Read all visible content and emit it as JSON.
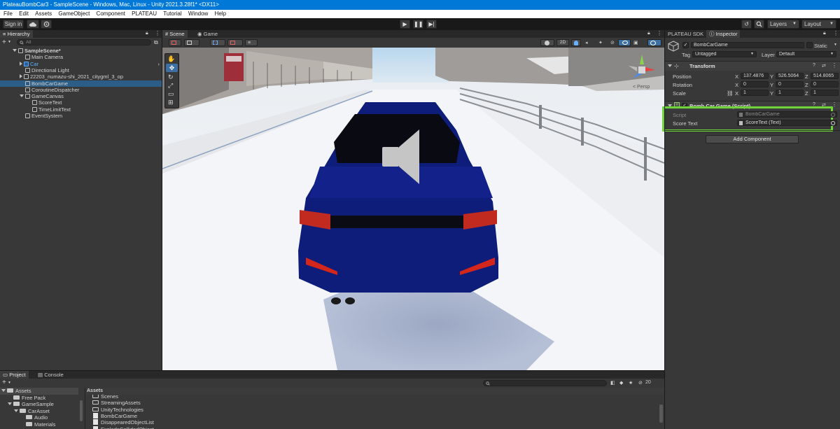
{
  "window": {
    "title": "PlateauBombCar3 - SampleScene - Windows, Mac, Linux - Unity 2021.3.28f1* <DX11>"
  },
  "menu": [
    "File",
    "Edit",
    "Assets",
    "GameObject",
    "Component",
    "PLATEAU",
    "Tutorial",
    "Window",
    "Help"
  ],
  "toolbar": {
    "sign_in": "Sign in",
    "layers": "Layers",
    "layout": "Layout"
  },
  "hierarchy": {
    "tab": "Hierarchy",
    "search_placeholder": "All",
    "items": [
      {
        "label": "SampleScene*",
        "depth": 0,
        "expanded": true,
        "icon": "unity-scene-icon"
      },
      {
        "label": "Main Camera",
        "depth": 1,
        "icon": "gameobject-icon"
      },
      {
        "label": "Car",
        "depth": 1,
        "collapsed": true,
        "icon": "prefab-icon",
        "accent": true
      },
      {
        "label": "Directional Light",
        "depth": 1,
        "icon": "gameobject-icon"
      },
      {
        "label": "22203_numazu-shi_2021_citygml_3_op",
        "depth": 1,
        "collapsed": true,
        "icon": "gameobject-icon"
      },
      {
        "label": "BombCarGame",
        "depth": 1,
        "icon": "gameobject-icon",
        "selected": true
      },
      {
        "label": "CoroutineDispatcher",
        "depth": 1,
        "icon": "gameobject-icon"
      },
      {
        "label": "GameCanvas",
        "depth": 1,
        "expanded": true,
        "icon": "gameobject-icon"
      },
      {
        "label": "ScoreText",
        "depth": 2,
        "icon": "gameobject-icon"
      },
      {
        "label": "TimeLimitText",
        "depth": 2,
        "icon": "gameobject-icon"
      },
      {
        "label": "EventSystem",
        "depth": 1,
        "icon": "gameobject-icon"
      }
    ]
  },
  "scene": {
    "tabs": [
      "Scene",
      "Game"
    ],
    "scale_2d": "2D",
    "gizmo_label": "< Persp"
  },
  "inspector": {
    "tabs": [
      "PLATEAU SDK",
      "Inspector"
    ],
    "object_name": "BombCarGame",
    "static_label": "Static",
    "tag_label": "Tag",
    "tag_value": "Untagged",
    "layer_label": "Layer",
    "layer_value": "Default",
    "transform": {
      "title": "Transform",
      "rows": [
        {
          "label": "Position",
          "x": "137.4876",
          "y": "526.5064",
          "z": "514.8065"
        },
        {
          "label": "Rotation",
          "x": "0",
          "y": "0",
          "z": "0"
        },
        {
          "label": "Scale",
          "x": "1",
          "y": "1",
          "z": "1"
        }
      ]
    },
    "script_component": {
      "title": "Bomb Car Game (Script)",
      "script_label": "Script",
      "script_value": "BombCarGame",
      "score_label": "Score Text",
      "score_value": "ScoreText (Text)"
    },
    "add_component": "Add Component"
  },
  "project": {
    "tabs": [
      "Project",
      "Console"
    ],
    "tree": [
      {
        "label": "Assets",
        "depth": 0
      },
      {
        "label": "Free Pack",
        "depth": 1
      },
      {
        "label": "GameSample",
        "depth": 1
      },
      {
        "label": "CarAsset",
        "depth": 2
      },
      {
        "label": "Audio",
        "depth": 3
      },
      {
        "label": "Materials",
        "depth": 3
      }
    ],
    "breadcrumb": "Assets",
    "files": [
      {
        "label": "Scenes",
        "icon": "folder-icon"
      },
      {
        "label": "StreamingAssets",
        "icon": "folder-icon"
      },
      {
        "label": "UnityTechnologies",
        "icon": "folder-icon"
      },
      {
        "label": "BombCarGame",
        "icon": "script-icon"
      },
      {
        "label": "DisappearedObjectList",
        "icon": "script-icon"
      },
      {
        "label": "ExplodeCollidedObject",
        "icon": "script-icon"
      }
    ],
    "hidden_count": "20"
  }
}
